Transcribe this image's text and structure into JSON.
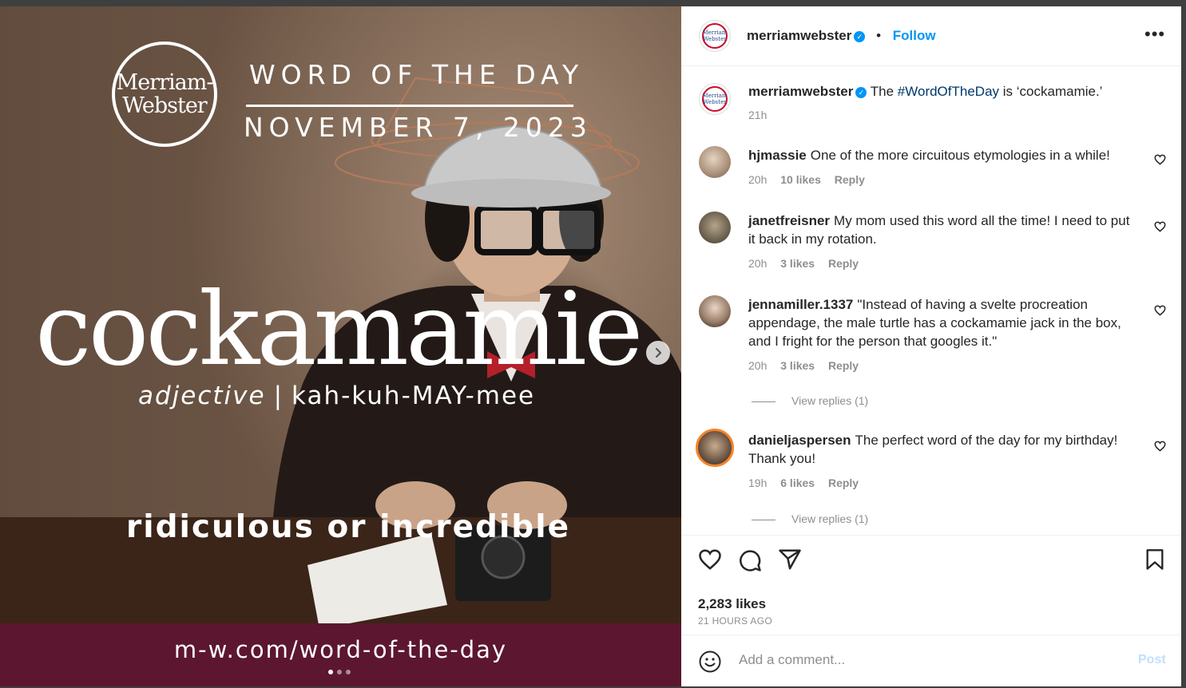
{
  "post": {
    "logo_line1": "Merriam-",
    "logo_line2": "Webster",
    "wotd_title": "WORD OF THE DAY",
    "wotd_date": "NOVEMBER 7, 2023",
    "headword": "cockamamie",
    "part_of_speech": "adjective",
    "separator": "|",
    "pronunciation": "kah-kuh-MAY-mee",
    "definition": "ridiculous or incredible",
    "url": "m-w.com/word-of-the-day",
    "carousel_pages": 3,
    "carousel_active": 1
  },
  "header": {
    "username": "merriamwebster",
    "dot": "•",
    "follow_label": "Follow",
    "more_icon": "more-horizontal-icon"
  },
  "caption": {
    "username": "merriamwebster",
    "text_before": "The",
    "hashtag": "#WordOfTheDay",
    "text_after": "is ‘cockamamie.’",
    "time": "21h"
  },
  "comments": [
    {
      "username": "hjmassie",
      "text": "One of the more circuitous etymologies in a while!",
      "time": "20h",
      "likes": "10 likes",
      "reply": "Reply"
    },
    {
      "username": "janetfreisner",
      "text": "My mom used this word all the time! I need to put it back in my rotation.",
      "time": "20h",
      "likes": "3 likes",
      "reply": "Reply"
    },
    {
      "username": "jennamiller.1337",
      "text": "\"Instead of having a svelte procreation appendage, the male turtle has a cockamamie jack in the box, and I fright for the person that googles it.\"",
      "time": "20h",
      "likes": "3 likes",
      "reply": "Reply",
      "view_replies": "View replies (1)"
    },
    {
      "username": "danieljaspersen",
      "text": "The perfect word of the day for my birthday! Thank you!",
      "time": "19h",
      "likes": "6 likes",
      "reply": "Reply",
      "view_replies": "View replies (1)"
    }
  ],
  "actions": {
    "likes": "2,283 likes",
    "time_ago": "21 HOURS AGO"
  },
  "add_comment": {
    "placeholder": "Add a comment...",
    "post_label": "Post"
  },
  "colors": {
    "accent": "#0095f6",
    "url_bar": "#5c1630",
    "mw_red": "#c8102e",
    "mw_blue": "#2a4b8d"
  }
}
